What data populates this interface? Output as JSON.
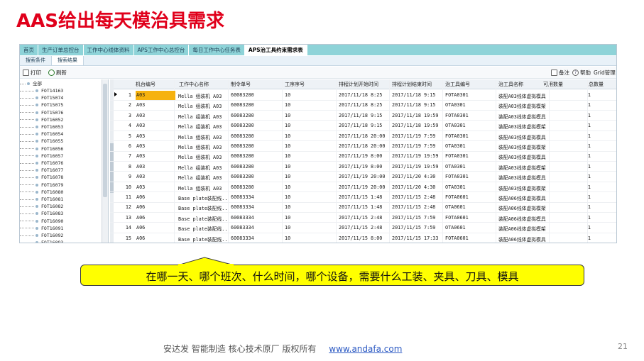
{
  "slide": {
    "title": "AAS给出每天模治具需求",
    "callout": "在哪一天、哪个班次、什么时间，哪个设备，需要什么工装、夹具、刀具、模具",
    "footer_text": "安达发   智能制造 核心技术原厂    版权所有",
    "footer_link": "www.andafa.com",
    "page_number": "21"
  },
  "app": {
    "nav_tabs": [
      "首页",
      "生产订单总控台",
      "工作中心线体资料",
      "APS工作中心总控台",
      "每日工作中心任务表",
      "APS治工具约束需求表"
    ],
    "active_nav_tab": 5,
    "sub_tabs": [
      "搜索条件",
      "搜索结果"
    ],
    "active_sub_tab": 1,
    "toolbar": {
      "print_label": "打印",
      "refresh_label": "刷新",
      "note_label": "备注",
      "help_label": "帮助",
      "grid_label": "Grid管理"
    },
    "tree": {
      "root_label": "全部",
      "items": [
        "FOT14163",
        "FOT15074",
        "FOT15075",
        "FOT15076",
        "FOT16052",
        "FOT16053",
        "FOT16054",
        "FOT16055",
        "FOT16056",
        "FOT16057",
        "FOT16076",
        "FOT16077",
        "FOT16078",
        "FOT16079",
        "FOT16080",
        "FOT16081",
        "FOT16082",
        "FOT16083",
        "FOT16090",
        "FOT16091",
        "FOT16092",
        "FOT16093"
      ]
    },
    "grid": {
      "columns": [
        "机台编号",
        "工作中心名称",
        "制令单号",
        "工序序号",
        "排程计划开始时间",
        "排程计划结束时间",
        "治工具编号",
        "治工具名称",
        "可用数量",
        "总数量"
      ],
      "rows": [
        [
          "1",
          "A03",
          "Mella 组装机 A03",
          "60083280",
          "10",
          "2017/11/18 8:25",
          "2017/11/18 9:15",
          "FOTA0301",
          "装配A03线体虚拟模具",
          "1"
        ],
        [
          "2",
          "A03",
          "Mella 组装机 A03",
          "60083280",
          "10",
          "2017/11/18 8:25",
          "2017/11/18 9:15",
          "OTA0301",
          "装配A03线体虚拟模架",
          "1"
        ],
        [
          "3",
          "A03",
          "Mella 组装机 A03",
          "60083280",
          "10",
          "2017/11/18 9:15",
          "2017/11/18 19:59",
          "FOTA0301",
          "装配A03线体虚拟模具",
          "1"
        ],
        [
          "4",
          "A03",
          "Mella 组装机 A03",
          "60083280",
          "10",
          "2017/11/18 9:15",
          "2017/11/18 19:59",
          "OTA0301",
          "装配A03线体虚拟模架",
          "1"
        ],
        [
          "5",
          "A03",
          "Mella 组装机 A03",
          "60083280",
          "10",
          "2017/11/18 20:00",
          "2017/11/19 7:59",
          "FOTA0301",
          "装配A03线体虚拟模具",
          "1"
        ],
        [
          "6",
          "A03",
          "Mella 组装机 A03",
          "60083280",
          "10",
          "2017/11/18 20:00",
          "2017/11/19 7:59",
          "OTA0301",
          "装配A03线体虚拟模架",
          "1"
        ],
        [
          "7",
          "A03",
          "Mella 组装机 A03",
          "60083280",
          "10",
          "2017/11/19 8:00",
          "2017/11/19 19:59",
          "FOTA0301",
          "装配A03线体虚拟模具",
          "1"
        ],
        [
          "8",
          "A03",
          "Mella 组装机 A03",
          "60083280",
          "10",
          "2017/11/19 8:00",
          "2017/11/19 19:59",
          "OTA0301",
          "装配A03线体虚拟模架",
          "1"
        ],
        [
          "9",
          "A03",
          "Mella 组装机 A03",
          "60083280",
          "10",
          "2017/11/19 20:00",
          "2017/11/20 4:30",
          "FOTA0301",
          "装配A03线体虚拟模具",
          "1"
        ],
        [
          "10",
          "A03",
          "Mella 组装机 A03",
          "60083280",
          "10",
          "2017/11/19 20:00",
          "2017/11/20 4:30",
          "OTA0301",
          "装配A03线体虚拟模架",
          "1"
        ],
        [
          "11",
          "A06",
          "Base plate装配线...",
          "60083334",
          "10",
          "2017/11/15 1:48",
          "2017/11/15 2:48",
          "FOTA0601",
          "装配A06线体虚拟模具",
          "1"
        ],
        [
          "12",
          "A06",
          "Base plate装配线...",
          "60083334",
          "10",
          "2017/11/15 1:48",
          "2017/11/15 2:48",
          "OTA0601",
          "装配A06线体虚拟模架",
          "1"
        ],
        [
          "13",
          "A06",
          "Base plate装配线...",
          "60083334",
          "10",
          "2017/11/15 2:48",
          "2017/11/15 7:59",
          "FOTA0601",
          "装配A06线体虚拟模具",
          "1"
        ],
        [
          "14",
          "A06",
          "Base plate装配线...",
          "60083334",
          "10",
          "2017/11/15 2:48",
          "2017/11/15 7:59",
          "OTA0601",
          "装配A06线体虚拟模架",
          "1"
        ],
        [
          "15",
          "A06",
          "Base plate装配线...",
          "60083334",
          "10",
          "2017/11/15 8:00",
          "2017/11/15 17:33",
          "FOTA0601",
          "装配A06线体虚拟模具",
          "1"
        ]
      ],
      "selected_row": 0
    }
  }
}
